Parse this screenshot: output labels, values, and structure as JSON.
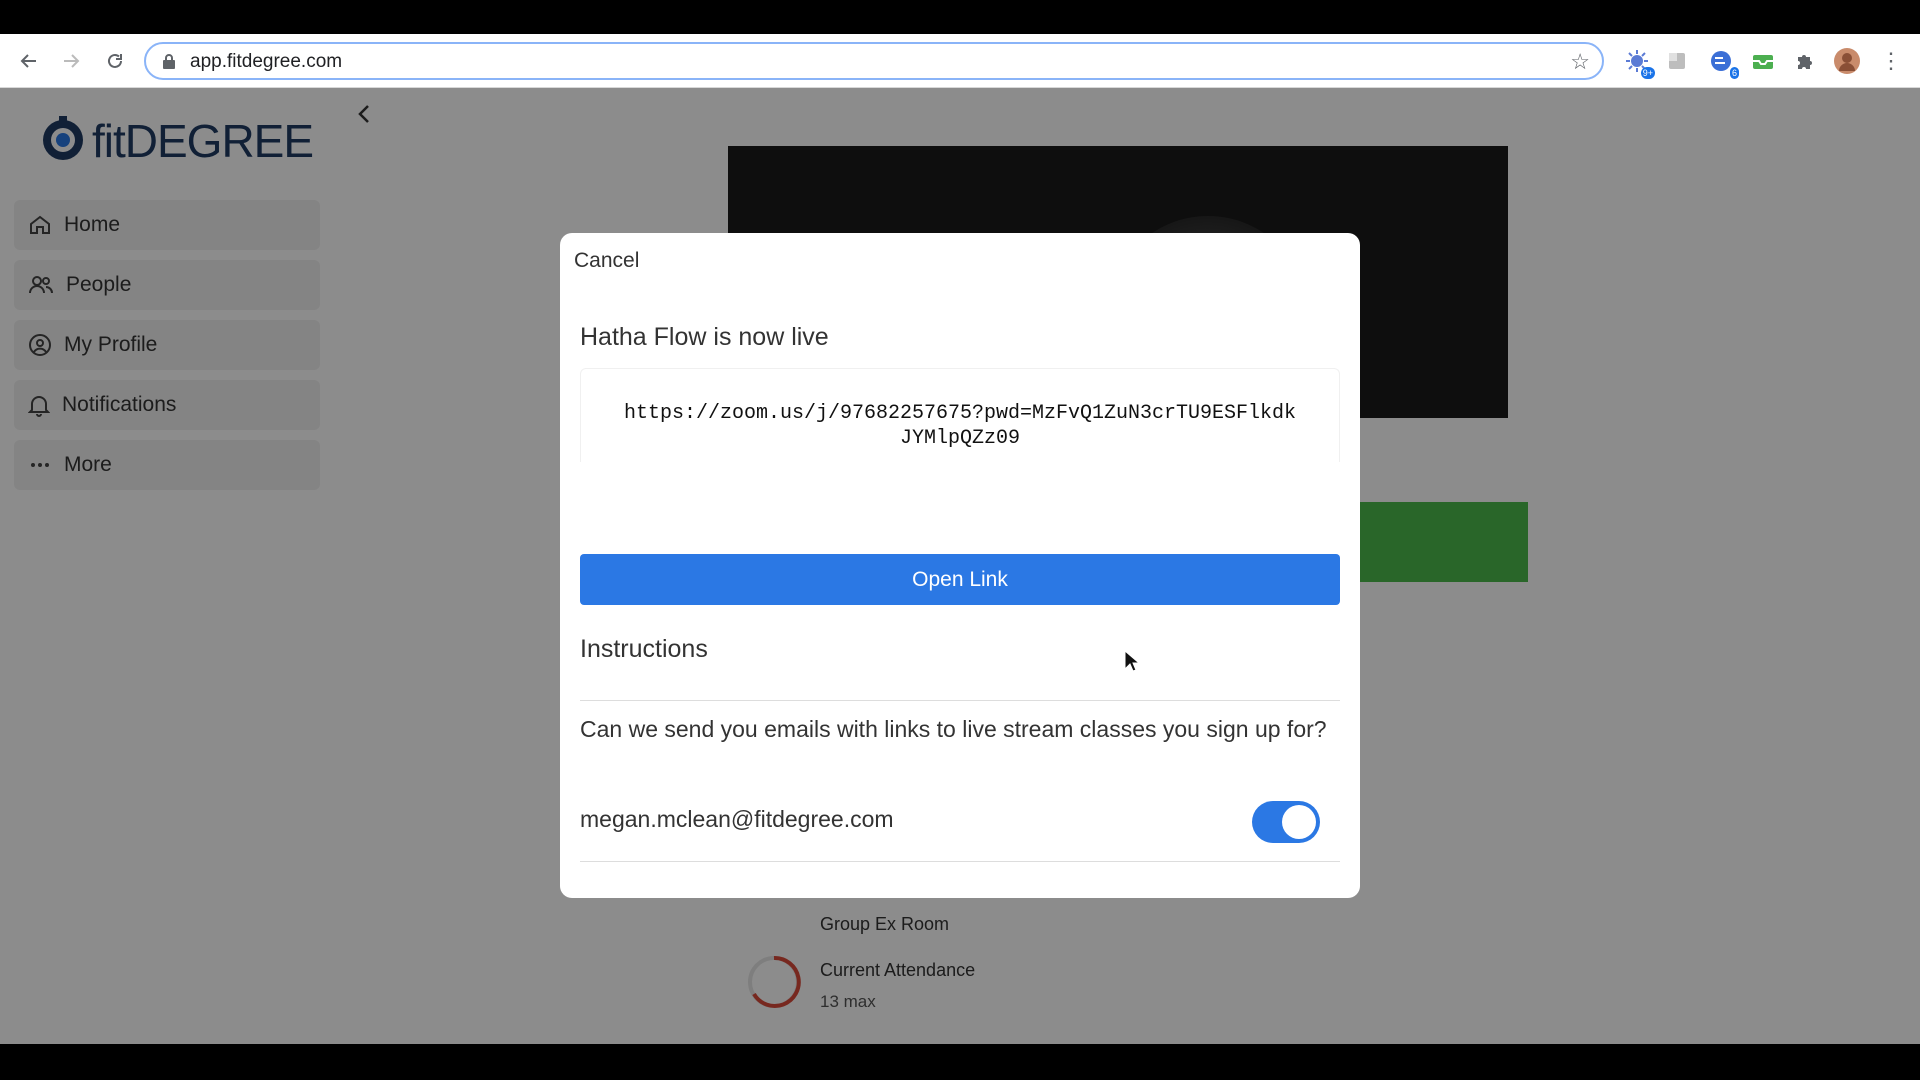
{
  "browser": {
    "url": "app.fitdegree.com",
    "extension_badges": [
      "9+",
      "6"
    ]
  },
  "app": {
    "logo_text": "fitDEGREE",
    "sidebar": {
      "items": [
        {
          "label": "Home",
          "icon": "home-icon"
        },
        {
          "label": "People",
          "icon": "people-icon"
        },
        {
          "label": "My Profile",
          "icon": "profile-icon"
        },
        {
          "label": "Notifications",
          "icon": "bell-icon"
        },
        {
          "label": "More",
          "icon": "more-icon"
        }
      ]
    },
    "background": {
      "room": "Group Ex Room",
      "attendance_label": "Current Attendance",
      "attendance_max": "13 max"
    }
  },
  "modal": {
    "cancel_label": "Cancel",
    "title": "Hatha Flow is now live",
    "link": "https://zoom.us/j/97682257675?pwd=MzFvQ1ZuN3crTU9ESFlkdkJYMlpQZz09",
    "open_link_label": "Open Link",
    "instructions_heading": "Instructions",
    "question": "Can we send you emails with links to live stream classes you sign up for?",
    "email": "megan.mclean@fitdegree.com",
    "toggle_on": true
  },
  "colors": {
    "primary": "#2b78e4",
    "green": "#4cbb4c",
    "logo": "#1f3b63"
  }
}
